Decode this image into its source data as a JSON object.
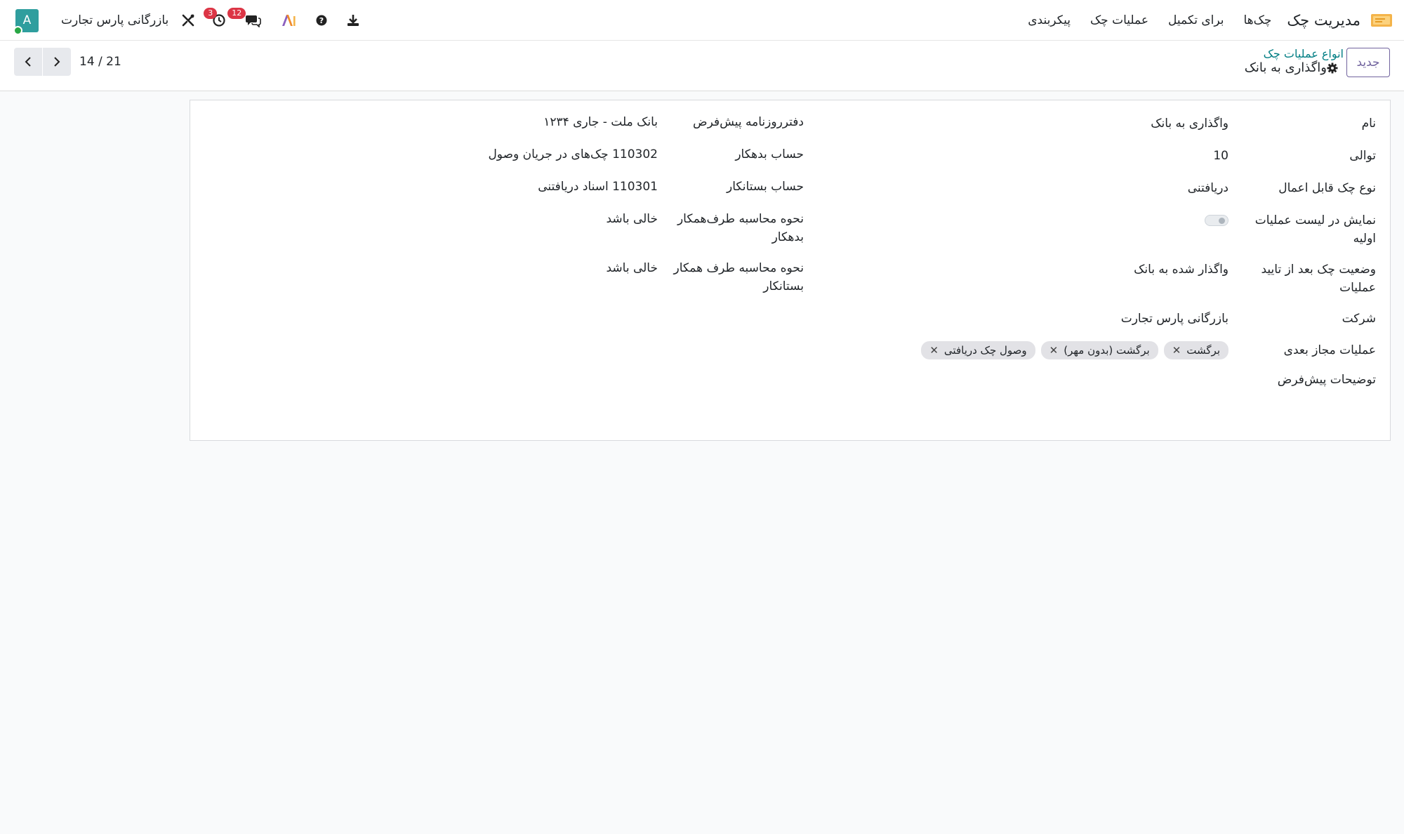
{
  "navbar": {
    "app_name": "مدیریت چک",
    "menu": [
      "چک‌ها",
      "برای تکمیل",
      "عملیات چک",
      "پیکربندی"
    ],
    "company": "بازرگانی پارس تجارت",
    "activity_count": "3",
    "messages_count": "12",
    "avatar_letter": "A"
  },
  "control_panel": {
    "new_label": "جدید",
    "breadcrumb_parent": "انواع عملیات چک",
    "breadcrumb_current": "واگذاری به بانک",
    "pager_value": "14 / 21"
  },
  "form": {
    "name_label": "نام",
    "name_value": "واگذاری به بانک",
    "sequence_label": "توالی",
    "sequence_value": "10",
    "check_type_label": "نوع چک قابل اعمال",
    "check_type_value": "دریافتنی",
    "show_initial_label": "نمایش در لیست عملیات اولیه",
    "show_initial_value": false,
    "state_after_label": "وضعیت چک بعد از تایید عملیات",
    "state_after_value": "واگذار شده به بانک",
    "company_label": "شرکت",
    "company_value": "بازرگانی پارس تجارت",
    "next_ops_label": "عملیات مجاز بعدی",
    "next_ops": [
      "برگشت",
      "برگشت (بدون مهر)",
      "وصول چک دریافتی"
    ],
    "description_label": "توضیحات پیش‌فرض",
    "journal_label": "دفترروزنامه پیش‌فرض",
    "journal_value": "بانک ملت - جاری ۱۲۳۴",
    "debit_label": "حساب بدهکار",
    "debit_value": "110302 چک‌های در جریان وصول",
    "credit_label": "حساب بستانکار",
    "credit_value": "110301 اسناد دریافتنی",
    "debit_partner_label": "نحوه محاسبه طرف‌همکار بدهکار",
    "debit_partner_value": "خالی باشد",
    "credit_partner_label": "نحوه محاسبه طرف همکار بستانکار",
    "credit_partner_value": "خالی باشد"
  }
}
